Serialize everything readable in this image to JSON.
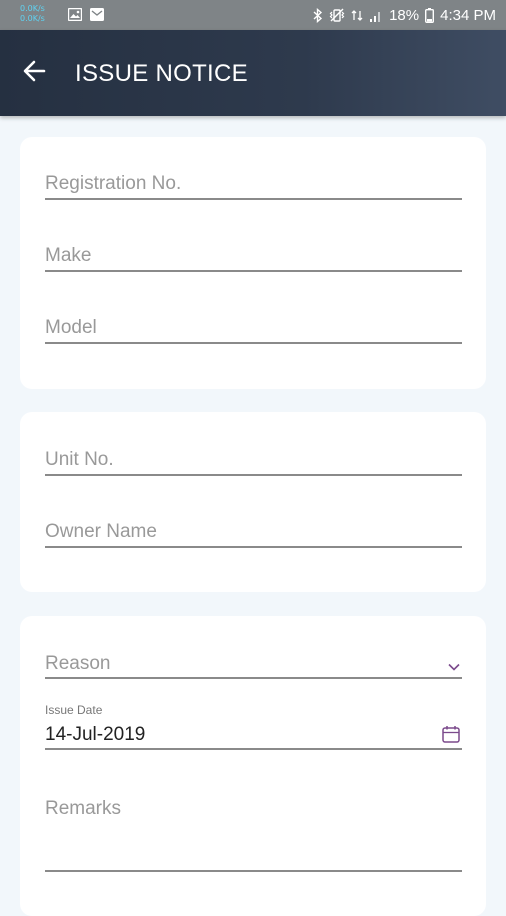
{
  "status_bar": {
    "net_speed_up": "0.0K/s",
    "net_speed_down": "0.0K/s",
    "battery": "18%",
    "time": "4:34 PM",
    "icons": [
      "image-icon",
      "mail-icon",
      "bluetooth-icon",
      "vibrate-icon",
      "data-icon",
      "signal-icon",
      "battery-icon"
    ]
  },
  "app_bar": {
    "title": "ISSUE NOTICE",
    "back_icon": "arrow-left-icon"
  },
  "vehicle_card": {
    "registration_placeholder": "Registration No.",
    "make_placeholder": "Make",
    "model_placeholder": "Model"
  },
  "owner_card": {
    "unit_placeholder": "Unit No.",
    "owner_placeholder": "Owner Name"
  },
  "notice_card": {
    "reason_placeholder": "Reason",
    "reason_icon": "chevron-down-icon",
    "issue_date_label": "Issue Date",
    "issue_date_value": "14-Jul-2019",
    "calendar_icon": "calendar-icon",
    "remarks_placeholder": "Remarks"
  },
  "colors": {
    "app_bar": "#2e3a4d",
    "background": "#f2f7fb",
    "accent": "#7b4a8c",
    "status_bar": "#7f8487"
  }
}
